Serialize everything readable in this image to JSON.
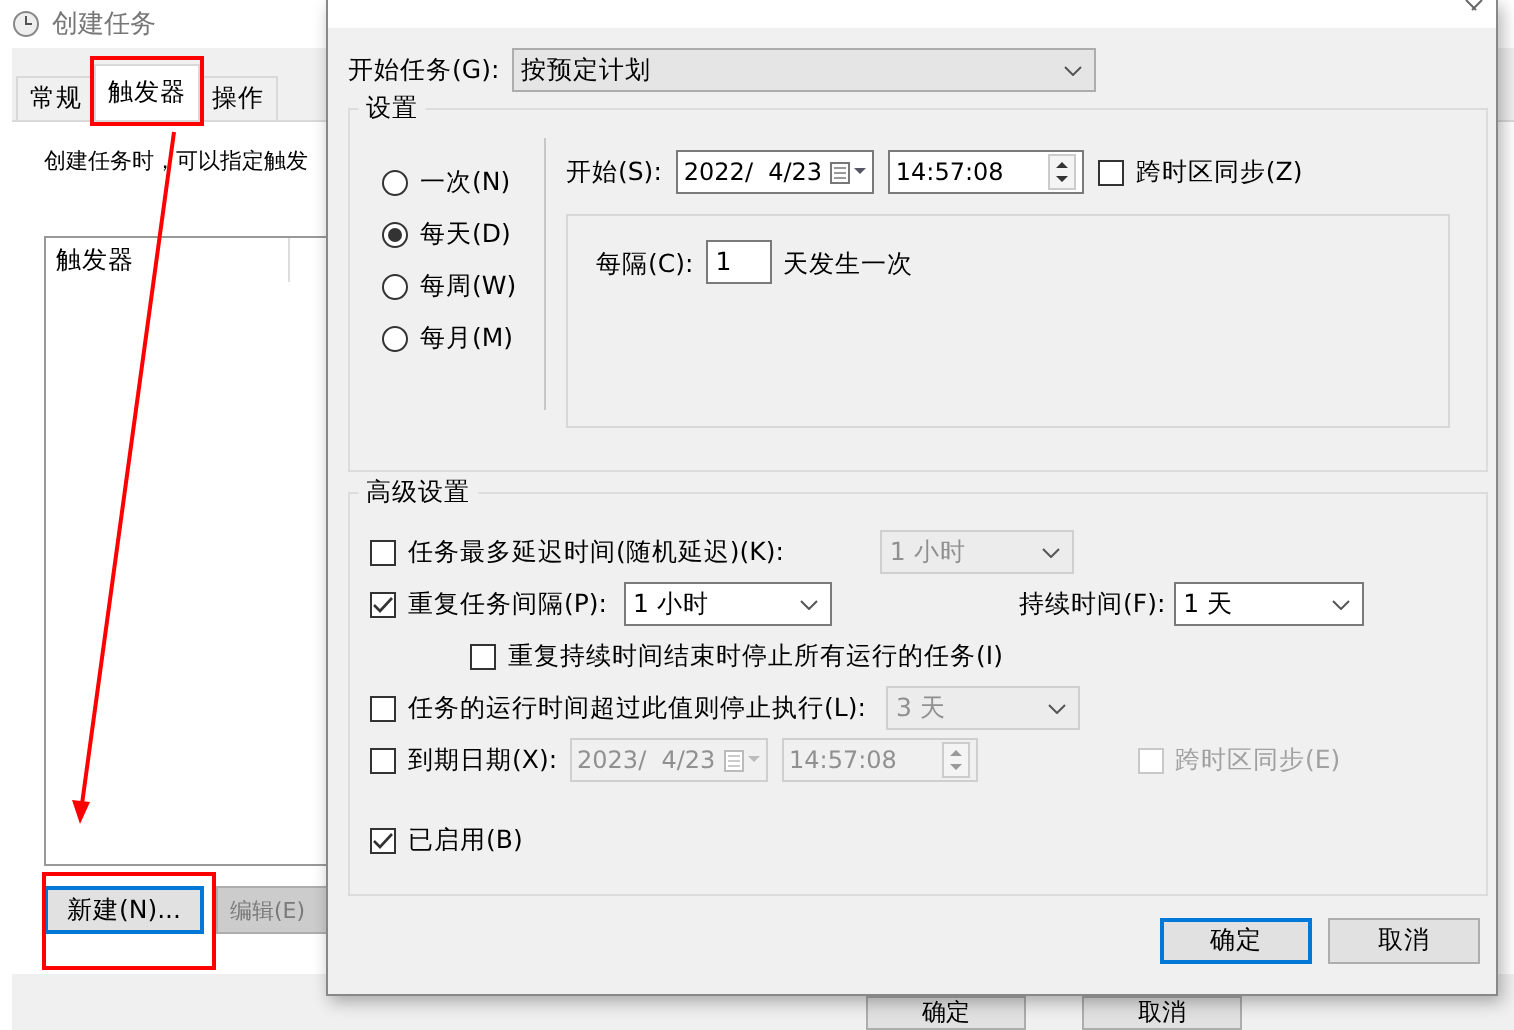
{
  "background_window": {
    "title": "创建任务",
    "tabs": [
      {
        "label": "常规",
        "selected": false
      },
      {
        "label": "触发器",
        "selected": true
      },
      {
        "label": "操作",
        "selected": false
      }
    ],
    "description": "创建任务时，可以指定触发",
    "table": {
      "columns": [
        "触发器"
      ]
    },
    "buttons": [
      {
        "label": "新建(N)...",
        "disabled": false,
        "focused": true
      },
      {
        "label": "编辑(E)",
        "disabled": true,
        "focused": false
      }
    ],
    "footer_buttons": [
      {
        "label": "确定"
      },
      {
        "label": "取消"
      }
    ]
  },
  "dialog": {
    "start_task": {
      "label": "开始任务(G):",
      "value": "按预定计划"
    },
    "settings": {
      "legend": "设置",
      "frequency": [
        {
          "label": "一次(N)",
          "selected": false
        },
        {
          "label": "每天(D)",
          "selected": true
        },
        {
          "label": "每周(W)",
          "selected": false
        },
        {
          "label": "每月(M)",
          "selected": false
        }
      ],
      "start": {
        "label": "开始(S):",
        "date": "2022/  4/23",
        "time": "14:57:08"
      },
      "sync_timezone": {
        "label": "跨时区同步(Z)",
        "checked": false
      },
      "interval": {
        "label": "每隔(C):",
        "value": "1",
        "suffix": "天发生一次"
      }
    },
    "advanced": {
      "legend": "高级设置",
      "delay": {
        "label": "任务最多延迟时间(随机延迟)(K):",
        "checked": false,
        "value": "1 小时"
      },
      "repeat": {
        "label": "重复任务间隔(P):",
        "checked": true,
        "value": "1 小时",
        "duration_label": "持续时间(F):",
        "duration_value": "1 天"
      },
      "stop_all": {
        "label": "重复持续时间结束时停止所有运行的任务(I)",
        "checked": false
      },
      "stop_after": {
        "label": "任务的运行时间超过此值则停止执行(L):",
        "checked": false,
        "value": "3 天"
      },
      "expiry": {
        "label": "到期日期(X):",
        "checked": false,
        "date": "2023/  4/23",
        "time": "14:57:08",
        "sync_label": "跨时区同步(E)",
        "sync_checked": false
      },
      "enabled": {
        "label": "已启用(B)",
        "checked": true
      }
    },
    "buttons": [
      {
        "label": "确定",
        "focused": true
      },
      {
        "label": "取消",
        "focused": false
      }
    ]
  }
}
